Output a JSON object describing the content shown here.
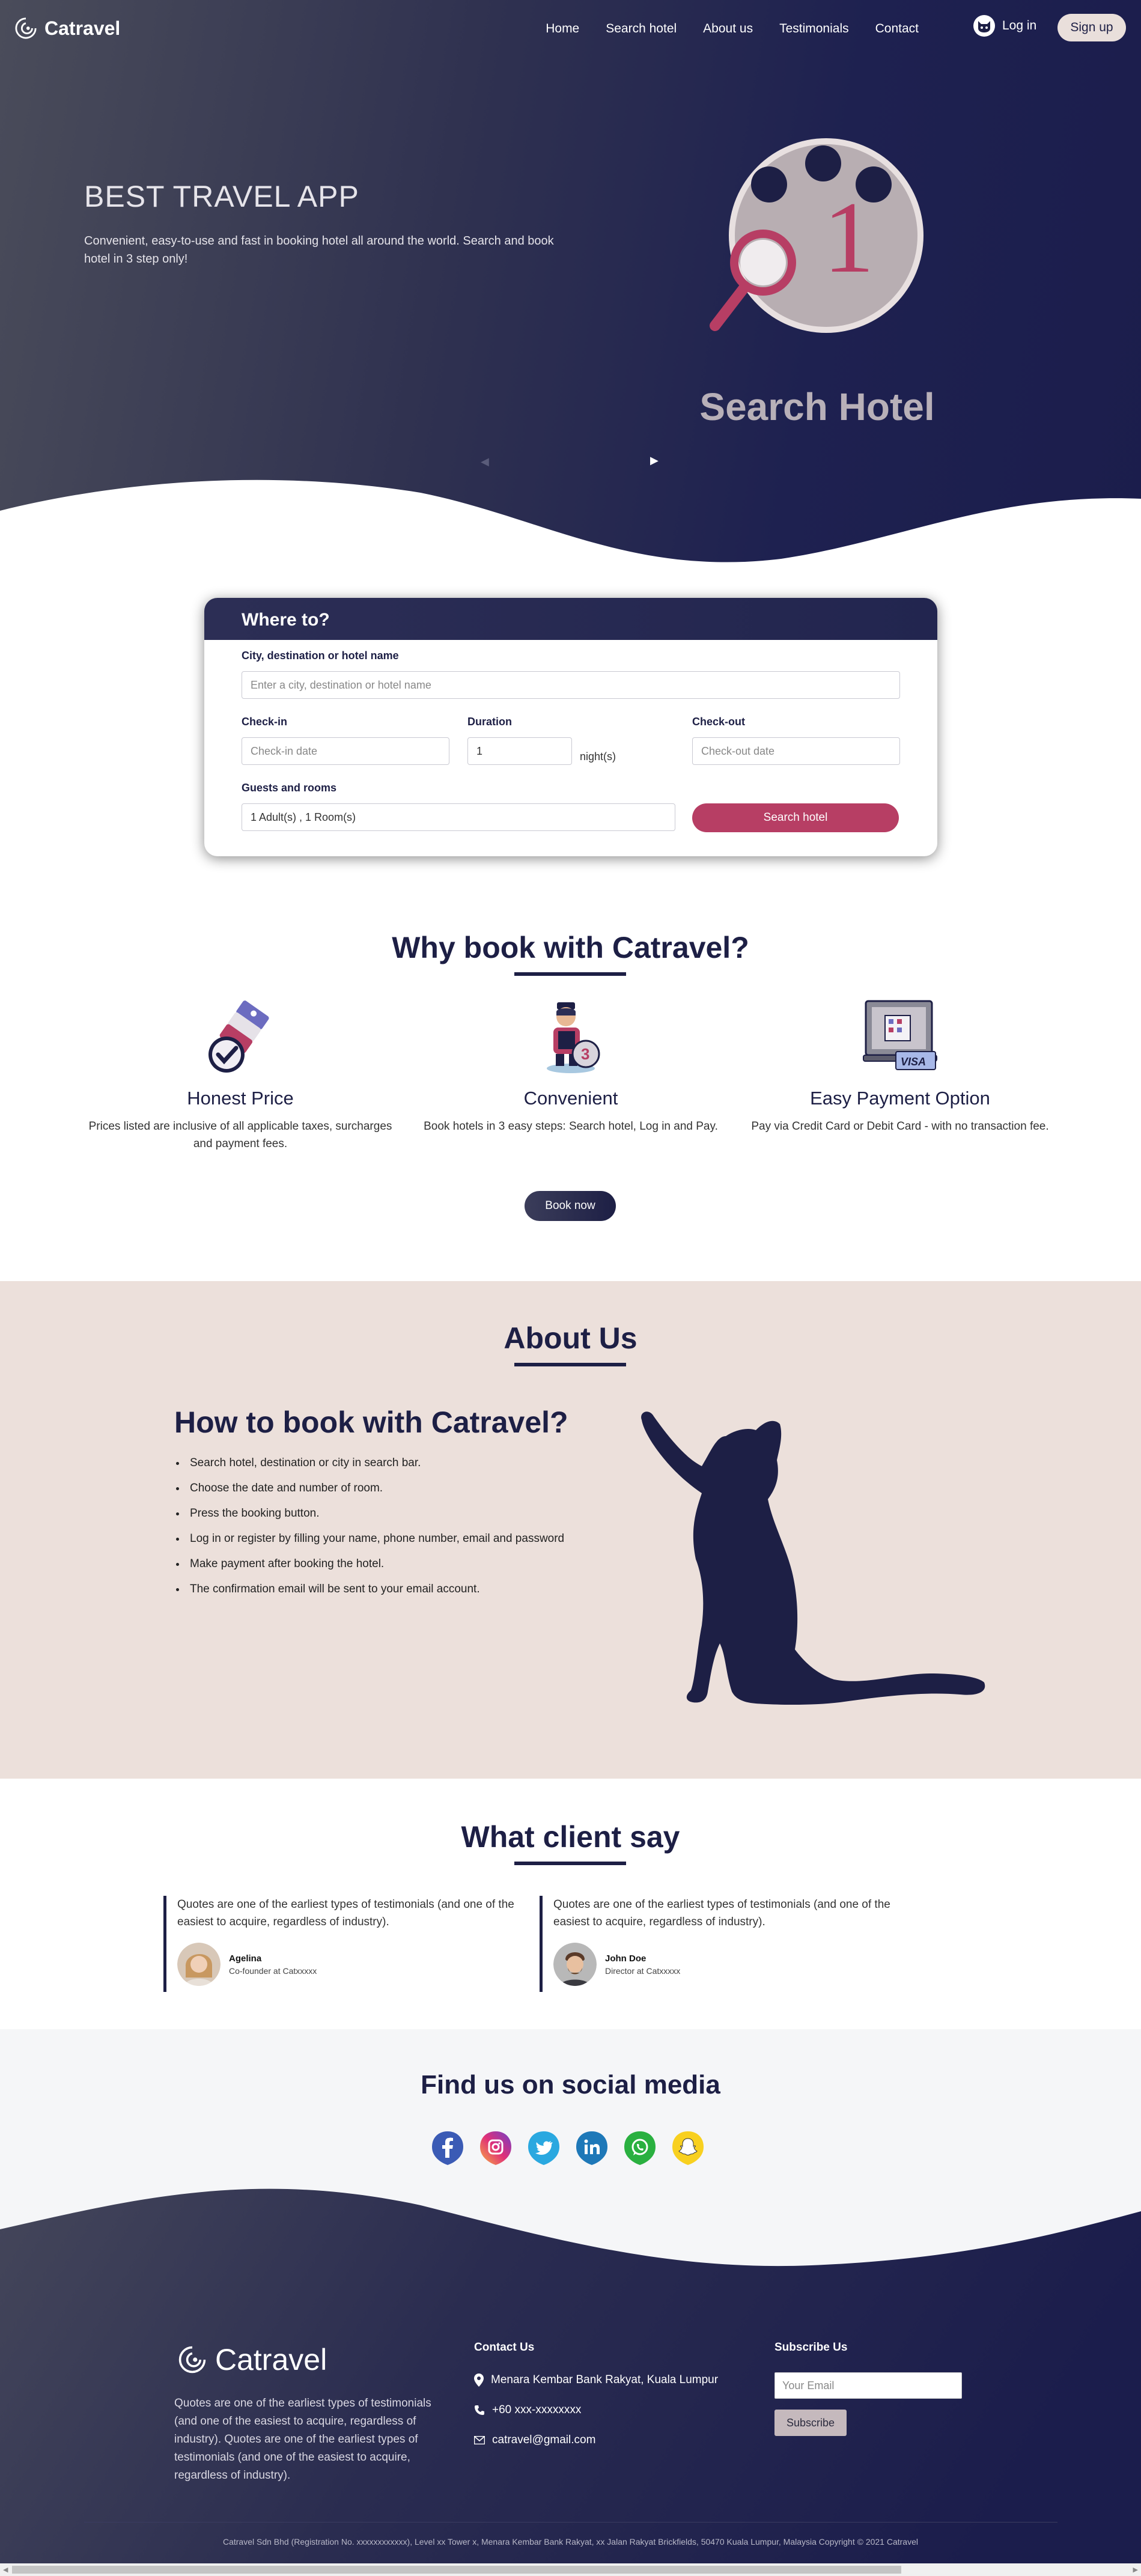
{
  "app": {
    "brand": "Catravel"
  },
  "nav": {
    "links": [
      "Home",
      "Search hotel",
      "About us",
      "Testimonials",
      "Contact"
    ],
    "login": "Log in",
    "signup": "Sign up"
  },
  "hero": {
    "title": "BEST TRAVEL APP",
    "description": "Convenient, easy-to-use and fast in booking hotel all around the world. Search and book hotel in 3 step only!",
    "slide_caption": "Search Hotel",
    "slide_number": "1"
  },
  "search": {
    "title": "Where to?",
    "destination_label": "City, destination or hotel name",
    "destination_placeholder": "Enter a city, destination or hotel name",
    "checkin_label": "Check-in",
    "checkin_placeholder": "Check-in date",
    "duration_label": "Duration",
    "duration_value": "1",
    "duration_unit": "night(s)",
    "checkout_label": "Check-out",
    "checkout_placeholder": "Check-out date",
    "guests_label": "Guests and rooms",
    "guests_value": "1 Adult(s) , 1 Room(s)",
    "button": "Search hotel"
  },
  "why": {
    "title": "Why book with Catravel?",
    "features": [
      {
        "icon": "price-tag-icon",
        "title": "Honest Price",
        "text": "Prices listed are inclusive of all applicable taxes, surcharges and payment fees."
      },
      {
        "icon": "traveler-icon",
        "title": "Convenient",
        "text": "Book hotels in 3 easy steps: Search hotel, Log in and Pay."
      },
      {
        "icon": "visa-card-icon",
        "title": "Easy Payment Option",
        "text": "Pay via Credit Card or Debit Card - with no transaction fee."
      }
    ],
    "button": "Book now"
  },
  "about": {
    "title": "About Us",
    "subtitle": "How to book with Catravel?",
    "steps": [
      "Search hotel, destination or city in search bar.",
      "Choose the date and number of room.",
      "Press the booking button.",
      "Log in or register by filling your name, phone number, email and password",
      "Make payment after booking the hotel.",
      "The confirmation email will be sent to your email account."
    ]
  },
  "testimonials": {
    "title": "What client say",
    "items": [
      {
        "quote": "Quotes are one of the earliest types of testimonials (and one of the easiest to acquire, regardless of industry).",
        "name": "Agelina",
        "role": "Co-founder at Catxxxxx"
      },
      {
        "quote": "Quotes are one of the earliest types of testimonials (and one of the easiest to acquire, regardless of industry).",
        "name": "John Doe",
        "role": "Director at Catxxxxx"
      }
    ]
  },
  "social": {
    "title": "Find us on social media",
    "icons": [
      "facebook-icon",
      "instagram-icon",
      "twitter-icon",
      "linkedin-icon",
      "whatsapp-icon",
      "snapchat-icon"
    ]
  },
  "footer": {
    "brand": "Catravel",
    "about": "Quotes are one of the earliest types of testimonials (and one of the easiest to acquire, regardless of industry). Quotes are one of the earliest types of testimonials (and one of the easiest to acquire, regardless of industry).",
    "contact_title": "Contact Us",
    "address": "Menara Kembar Bank Rakyat, Kuala Lumpur",
    "phone": "+60 xxx-xxxxxxxx",
    "email": "catravel@gmail.com",
    "subscribe_title": "Subscribe Us",
    "subscribe_placeholder": "Your Email",
    "subscribe_button": "Subscribe",
    "copyright": "Catravel Sdn Bhd (Registration No. xxxxxxxxxxxx), Level xx Tower x, Menara Kembar Bank Rakyat, xx Jalan Rakyat Brickfields, 50470 Kuala Lumpur, Malaysia Copyright © 2021 Catravel"
  },
  "colors": {
    "navy": "#1d1f45",
    "accent": "#b73e64",
    "about_bg": "#ece0db",
    "social_bg": "#f5f6f8"
  }
}
